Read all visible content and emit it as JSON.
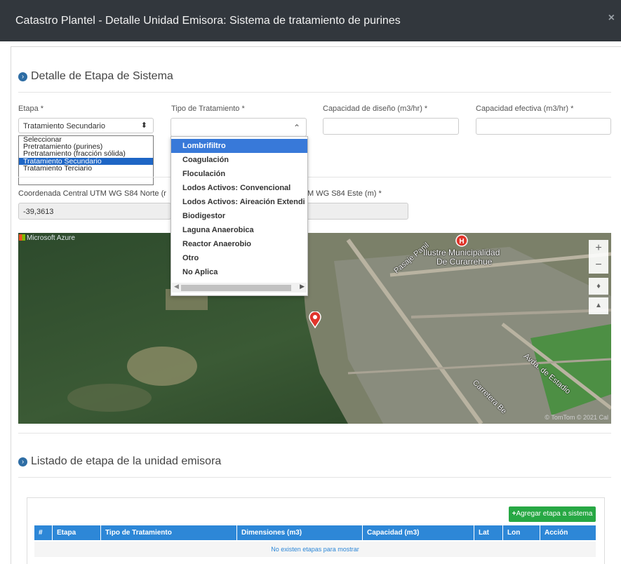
{
  "modal": {
    "title": "Catastro Plantel - Detalle Unidad Emisora: Sistema de tratamiento de purines",
    "close": "×"
  },
  "detail": {
    "heading": "Detalle de Etapa de Sistema",
    "etapa": {
      "label": "Etapa *",
      "value": "Tratamiento Secundario",
      "options": [
        "Seleccionar",
        "Pretratamiento (purines)",
        "Pretratamiento (fracción sólida)",
        "Tratamiento Secundario",
        "Tratamiento Terciario"
      ]
    },
    "tipo": {
      "label": "Tipo de Tratamiento *",
      "options": [
        "Lombrifiltro",
        "Coagulación",
        "Floculación",
        "Lodos Activos: Convencional",
        "Lodos Activos: Aireación Extendi",
        "Biodigestor",
        "Laguna Anaerobica",
        "Reactor Anaerobio",
        "Otro",
        "No Aplica"
      ]
    },
    "cap_diseno": {
      "label": "Capacidad de diseño (m3/hr) *"
    },
    "cap_efectiva": {
      "label": "Capacidad efectiva (m3/hr) *"
    },
    "norte": {
      "label": "Coordenada Central UTM WG S84 Norte (r",
      "value": "-39,3613"
    },
    "este": {
      "label": "M WG S84 Este (m) *"
    }
  },
  "map": {
    "brand": "Microsoft Azure",
    "labels": {
      "street1": "Pasaje Panil",
      "muni1": "Ilustre Municipalidad",
      "muni2": "De Curarrehue",
      "avenida": "Avda. de Estadio",
      "carretera": "Carretera Be"
    },
    "copyright": "© TomTom © 2021 Cal",
    "controls": {
      "zoom_in": "+",
      "zoom_out": "−",
      "compass": "♦",
      "tilt": "▲"
    }
  },
  "listado": {
    "heading": "Listado de etapa de la unidad emisora",
    "add_button": "Agregar etapa a sistema",
    "columns": [
      "#",
      "Etapa",
      "Tipo de Tratamiento",
      "Dimensiones (m3)",
      "Capacidad (m3)",
      "Lat",
      "Lon",
      "Acción"
    ],
    "empty": "No existen etapas para mostrar"
  },
  "colors": {
    "header_bg": "#32373d",
    "primary": "#2d87d7",
    "success": "#27a844",
    "highlight": "#3879d9"
  }
}
